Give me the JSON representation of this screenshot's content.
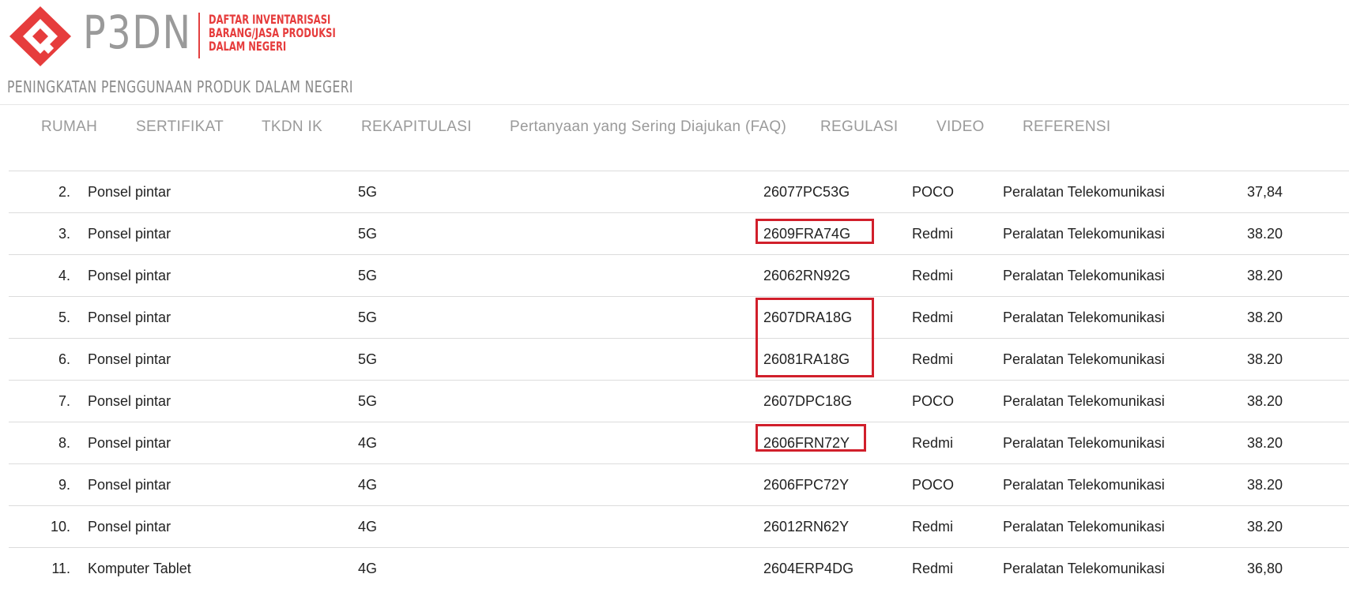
{
  "header": {
    "logo_text": "P3DN",
    "logo_desc_lines": [
      "DAFTAR INVENTARISASI",
      "BARANG/JASA PRODUKSI",
      "DALAM NEGERI"
    ],
    "tagline": "PENINGKATAN PENGGUNAAN PRODUK DALAM NEGERI",
    "brand_color": "#e63c3c"
  },
  "nav": {
    "items": [
      {
        "label": "RUMAH"
      },
      {
        "label": "SERTIFIKAT"
      },
      {
        "label": "TKDN IK"
      },
      {
        "label": "REKAPITULASI"
      },
      {
        "label": "Pertanyaan yang Sering Diajukan (FAQ)"
      },
      {
        "label": "REGULASI"
      },
      {
        "label": "VIDEO"
      },
      {
        "label": "REFERENSI"
      }
    ]
  },
  "table": {
    "rows": [
      {
        "no": "2.",
        "name": "Ponsel pintar",
        "spec": "5G",
        "code": "26077PC53G",
        "brand": "POCO",
        "type": "Peralatan Telekomunikasi",
        "value": "37,84"
      },
      {
        "no": "3.",
        "name": "Ponsel pintar",
        "spec": "5G",
        "code": "2609FRA74G",
        "brand": "Redmi",
        "type": "Peralatan Telekomunikasi",
        "value": "38.20"
      },
      {
        "no": "4.",
        "name": "Ponsel pintar",
        "spec": "5G",
        "code": "26062RN92G",
        "brand": "Redmi",
        "type": "Peralatan Telekomunikasi",
        "value": "38.20"
      },
      {
        "no": "5.",
        "name": "Ponsel pintar",
        "spec": "5G",
        "code": "2607DRA18G",
        "brand": "Redmi",
        "type": "Peralatan Telekomunikasi",
        "value": "38.20"
      },
      {
        "no": "6.",
        "name": "Ponsel pintar",
        "spec": "5G",
        "code": "26081RA18G",
        "brand": "Redmi",
        "type": "Peralatan Telekomunikasi",
        "value": "38.20"
      },
      {
        "no": "7.",
        "name": "Ponsel pintar",
        "spec": "5G",
        "code": "2607DPC18G",
        "brand": "POCO",
        "type": "Peralatan Telekomunikasi",
        "value": "38.20"
      },
      {
        "no": "8.",
        "name": "Ponsel pintar",
        "spec": "4G",
        "code": "2606FRN72Y",
        "brand": "Redmi",
        "type": "Peralatan Telekomunikasi",
        "value": "38.20"
      },
      {
        "no": "9.",
        "name": "Ponsel pintar",
        "spec": "4G",
        "code": "2606FPC72Y",
        "brand": "POCO",
        "type": "Peralatan Telekomunikasi",
        "value": "38.20"
      },
      {
        "no": "10.",
        "name": "Ponsel pintar",
        "spec": "4G",
        "code": "26012RN62Y",
        "brand": "Redmi",
        "type": "Peralatan Telekomunikasi",
        "value": "38.20"
      },
      {
        "no": "11.",
        "name": "Komputer Tablet",
        "spec": "4G",
        "code": "2604ERP4DG",
        "brand": "Redmi",
        "type": "Peralatan Telekomunikasi",
        "value": "36,80"
      }
    ]
  },
  "highlight_color": "#d11f2b"
}
